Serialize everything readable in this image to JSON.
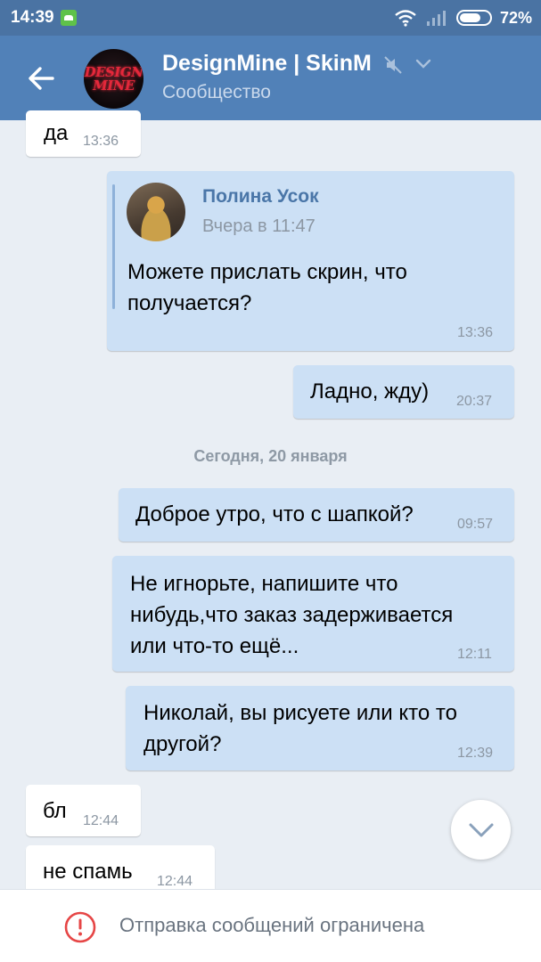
{
  "status_bar": {
    "time": "14:39",
    "battery": "72%",
    "battery_level": 0.72
  },
  "header": {
    "title": "DesignMine | SkinM",
    "subtitle": "Сообщество",
    "avatar_logo": [
      "DESIGN",
      "MINE"
    ]
  },
  "messages": [
    {
      "text": "да",
      "time": "13:36"
    },
    {
      "forwarded": {
        "author": "Полина Усок",
        "date": "Вчера в 11:47",
        "text": "Можете прислать скрин, что\nполучается?"
      },
      "time": "13:36"
    },
    {
      "text": "Ладно, жду)",
      "time": "20:37"
    },
    {
      "text": "Доброе утро, что с шапкой?",
      "time": "09:57"
    },
    {
      "text": "Не игнорьте, напишите что\nнибудь,что заказ задерживается\nили что-то ещё...",
      "time": "12:11"
    },
    {
      "text": "Николай, вы рисуете или кто то\nдругой?",
      "time": "12:39"
    },
    {
      "text": "бл",
      "time": "12:44"
    },
    {
      "text": "не спамь",
      "time": "12:44"
    }
  ],
  "date_separator": "Сегодня, 20 января",
  "bottom_bar": {
    "notice": "Отправка сообщений ограничена"
  },
  "colors": {
    "header": "#5181b8",
    "status_bar": "#4a73a3",
    "background": "#e9eef4",
    "outgoing_bubble": "#cce0f5",
    "incoming_bubble": "#ffffff",
    "warning": "#e64646"
  },
  "icons": [
    "back-arrow-icon",
    "mute-icon",
    "chevron-down-icon",
    "scroll-down-icon",
    "warning-icon",
    "wifi-icon",
    "signal-icon",
    "battery-icon"
  ]
}
